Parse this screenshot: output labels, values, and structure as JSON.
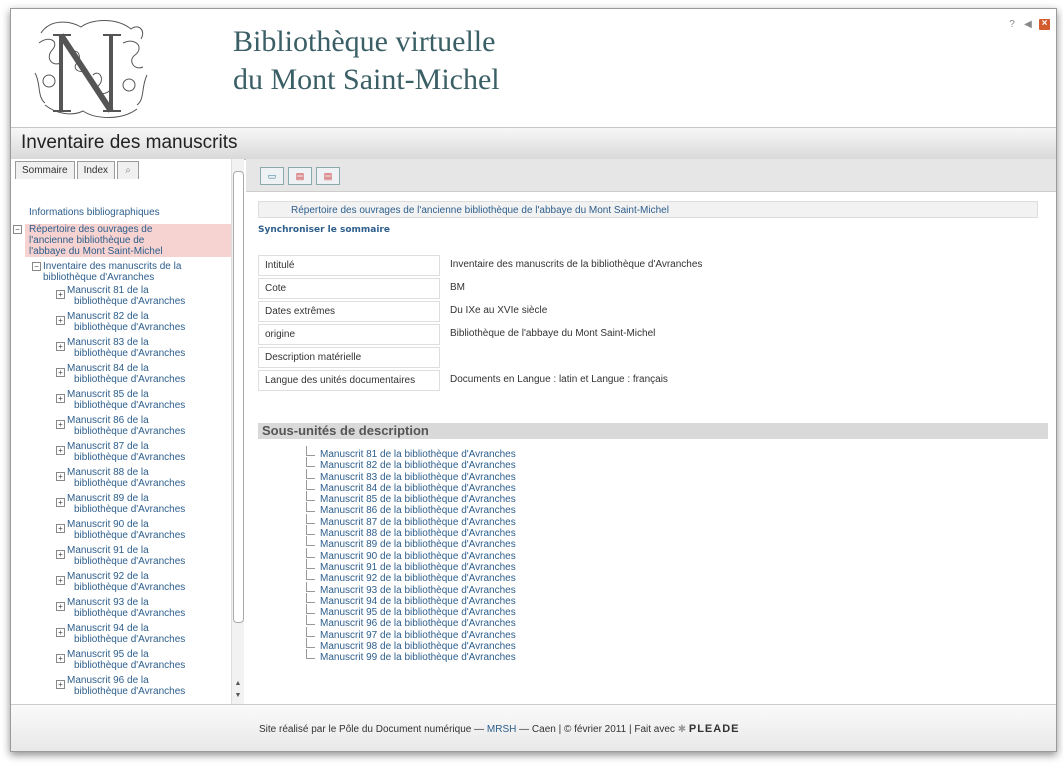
{
  "header": {
    "title_line1": "Bibliothèque virtuelle",
    "title_line2": "du Mont Saint-Michel"
  },
  "titlebar": {
    "title": "Inventaire des manuscrits"
  },
  "sidebar": {
    "tabs": [
      "Sommaire",
      "Index"
    ],
    "tree_top": "Informations bibliographiques",
    "tree_selected": [
      "Répertoire des ouvrages de",
      "l'ancienne bibliothèque de",
      "l'abbaye du Mont Saint-Michel"
    ],
    "tree_level2": [
      "Inventaire des manuscrits de la",
      "bibliothèque d'Avranches"
    ],
    "manuscripts": [
      {
        "l1": "Manuscrit 81 de la",
        "l2": "bibliothèque d'Avranches"
      },
      {
        "l1": "Manuscrit 82 de la",
        "l2": "bibliothèque d'Avranches"
      },
      {
        "l1": "Manuscrit 83 de la",
        "l2": "bibliothèque d'Avranches"
      },
      {
        "l1": "Manuscrit 84 de la",
        "l2": "bibliothèque d'Avranches"
      },
      {
        "l1": "Manuscrit 85 de la",
        "l2": "bibliothèque d'Avranches"
      },
      {
        "l1": "Manuscrit 86 de la",
        "l2": "bibliothèque d'Avranches"
      },
      {
        "l1": "Manuscrit 87 de la",
        "l2": "bibliothèque d'Avranches"
      },
      {
        "l1": "Manuscrit 88 de la",
        "l2": "bibliothèque d'Avranches"
      },
      {
        "l1": "Manuscrit 89 de la",
        "l2": "bibliothèque d'Avranches"
      },
      {
        "l1": "Manuscrit 90 de la",
        "l2": "bibliothèque d'Avranches"
      },
      {
        "l1": "Manuscrit 91 de la",
        "l2": "bibliothèque d'Avranches"
      },
      {
        "l1": "Manuscrit 92 de la",
        "l2": "bibliothèque d'Avranches"
      },
      {
        "l1": "Manuscrit 93 de la",
        "l2": "bibliothèque d'Avranches"
      },
      {
        "l1": "Manuscrit 94 de la",
        "l2": "bibliothèque d'Avranches"
      },
      {
        "l1": "Manuscrit 95 de la",
        "l2": "bibliothèque d'Avranches"
      },
      {
        "l1": "Manuscrit 96 de la",
        "l2": "bibliothèque d'Avranches"
      }
    ]
  },
  "main": {
    "breadcrumb": "Répertoire des ouvrages de l'ancienne bibliothèque de l'abbaye du Mont Saint-Michel",
    "sync_label": "Synchroniser le sommaire",
    "metadata": [
      {
        "key": "Intitulé",
        "value": "Inventaire des manuscrits de la bibliothèque d'Avranches"
      },
      {
        "key": "Cote",
        "value": "BM"
      },
      {
        "key": "Dates extrêmes",
        "value": "Du IXe au XVIe siècle"
      },
      {
        "key": "origine",
        "value": "Bibliothèque de l'abbaye du Mont Saint-Michel"
      },
      {
        "key": "Description matérielle",
        "value": ""
      },
      {
        "key": "Langue des unités documentaires",
        "value": "Documents en Langue : latin et Langue : français"
      }
    ],
    "subunits_heading": "Sous-unités de description",
    "subunits": [
      "Manuscrit 81 de la bibliothèque d'Avranches",
      "Manuscrit 82 de la bibliothèque d'Avranches",
      "Manuscrit 83 de la bibliothèque d'Avranches",
      "Manuscrit 84 de la bibliothèque d'Avranches",
      "Manuscrit 85 de la bibliothèque d'Avranches",
      "Manuscrit 86 de la bibliothèque d'Avranches",
      "Manuscrit 87 de la bibliothèque d'Avranches",
      "Manuscrit 88 de la bibliothèque d'Avranches",
      "Manuscrit 89 de la bibliothèque d'Avranches",
      "Manuscrit 90 de la bibliothèque d'Avranches",
      "Manuscrit 91 de la bibliothèque d'Avranches",
      "Manuscrit 92 de la bibliothèque d'Avranches",
      "Manuscrit 93 de la bibliothèque d'Avranches",
      "Manuscrit 94 de la bibliothèque d'Avranches",
      "Manuscrit 95 de la bibliothèque d'Avranches",
      "Manuscrit 96 de la bibliothèque d'Avranches",
      "Manuscrit 97 de la bibliothèque d'Avranches",
      "Manuscrit 98 de la bibliothèque d'Avranches",
      "Manuscrit 99 de la bibliothèque d'Avranches"
    ]
  },
  "footer": {
    "text_before": "Site réalisé par le Pôle du Document numérique — ",
    "link": "MRSH",
    "text_after": " — Caen | © février 2011 | Fait avec ",
    "brand": "PLEADE"
  },
  "colors": {
    "link": "#2d5e8c",
    "title": "#3b5f66",
    "selected": "#f6d3d0"
  },
  "icons": [
    "help-icon",
    "speaker-icon",
    "close-icon",
    "search-icon",
    "folder-icon",
    "pdf-icon"
  ]
}
